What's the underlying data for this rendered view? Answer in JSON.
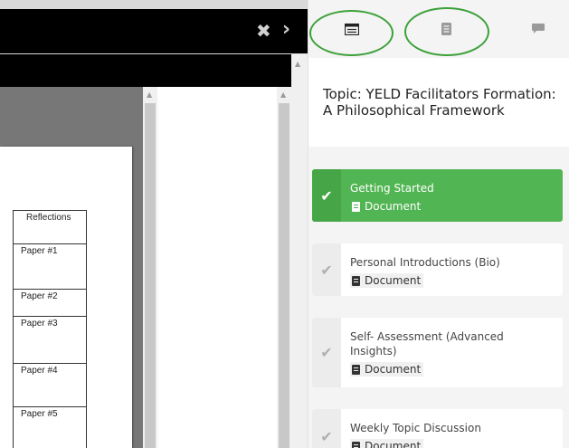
{
  "viewer": {
    "close_glyph": "✖",
    "next_glyph": "›",
    "table": {
      "header": "Reflections",
      "rows": [
        "Paper #1",
        "Paper #2",
        "Paper #3",
        "Paper #4",
        "Paper #5"
      ]
    }
  },
  "panel": {
    "tabs": [
      {
        "icon": "list-icon",
        "active": true
      },
      {
        "icon": "document-icon",
        "active": false
      },
      {
        "icon": "chat-icon",
        "active": false
      }
    ],
    "topic_title": "Topic: YELD Facilitators Formation: A Philosophical Framework",
    "items": [
      {
        "title": "Getting Started",
        "type": "Document",
        "status": "active"
      },
      {
        "title": "Personal Introductions (Bio)",
        "type": "Document",
        "status": "incomplete"
      },
      {
        "title": "Self- Assessment (Advanced Insights)",
        "type": "Document",
        "status": "incomplete"
      },
      {
        "title": "Weekly Topic Discussion",
        "type": "Document",
        "status": "incomplete"
      }
    ]
  },
  "colors": {
    "accent_green": "#52b553",
    "annotation_green": "#3da13a"
  }
}
